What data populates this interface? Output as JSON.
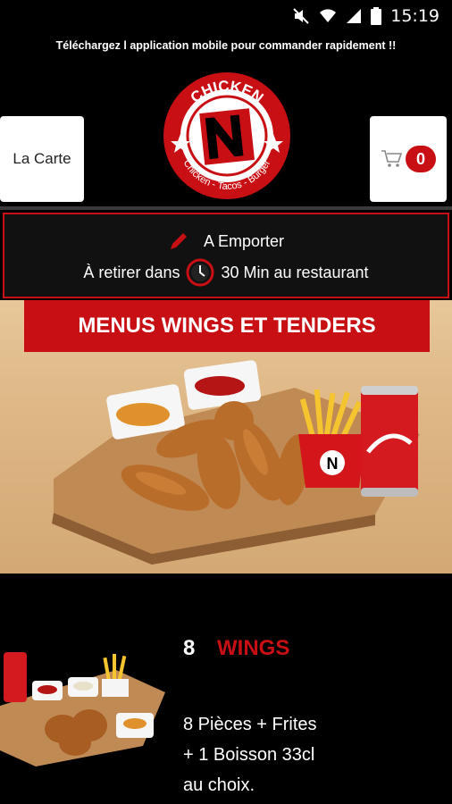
{
  "status_bar": {
    "time": "15:19"
  },
  "promo": {
    "text": "Téléchargez l application mobile pour commander rapidement !!"
  },
  "header": {
    "menu_button_label": "La Carte",
    "cart_count": "0",
    "logo": {
      "top_text": "CHICKEN",
      "letter": "N",
      "bottom_text": "Chicken - Tacos - Burger"
    }
  },
  "order_info": {
    "mode": "A Emporter",
    "pickup_prefix": "À retirer dans",
    "pickup_time": "30 Min au restaurant"
  },
  "hero": {
    "title": "MENUS WINGS ET TENDERS"
  },
  "menu_item": {
    "quantity": "8",
    "name": "WINGS",
    "description": "8 Pièces + Frites\n+ 1 Boisson 33cl\nau choix."
  },
  "colors": {
    "accent": "#c80f14",
    "background": "#000000",
    "wood": "#deb785"
  }
}
